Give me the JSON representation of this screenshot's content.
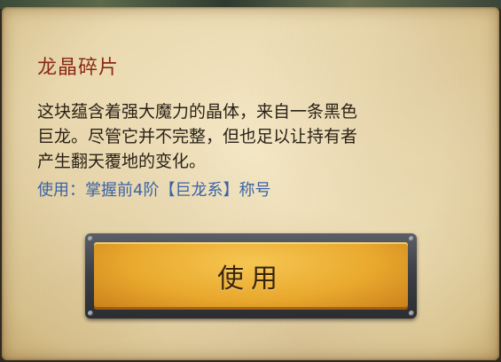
{
  "item": {
    "name": "龙晶碎片",
    "description_lines": [
      "这块蕴含着强大魔力的晶体，来自一条黑色",
      "巨龙。尽管它并不完整，但也足以让持有者",
      "产生翻天覆地的变化。"
    ],
    "usage_text": "使用：掌握前4阶【巨龙系】称号"
  },
  "actions": {
    "use_button_label": "使用"
  },
  "colors": {
    "title": "#8a2a14",
    "usage": "#3a63a8",
    "button_gold": "#e9a92e"
  }
}
